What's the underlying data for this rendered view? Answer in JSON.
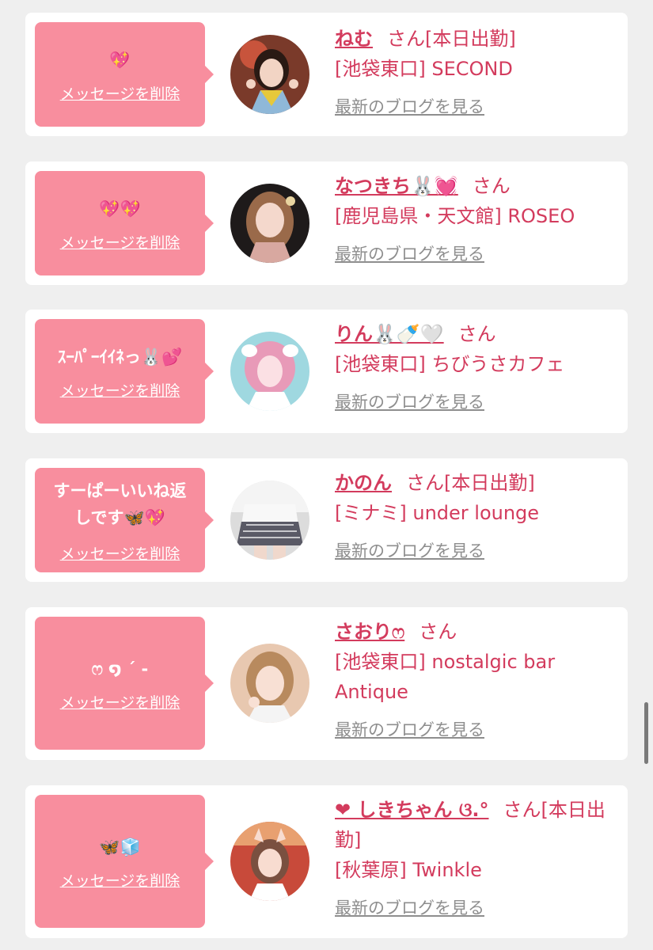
{
  "delete_label": "メッセージを削除",
  "blog_label": "最新のブログを見る",
  "entries": [
    {
      "message": "💖",
      "name": "ねむ",
      "suffix": "さん[本日出勤]",
      "shop": "[池袋東口] SECOND"
    },
    {
      "message": "💖💖",
      "name": "なつきち🐰💓",
      "suffix": "さん",
      "shop": "[鹿児島県・天文館] ROSEO"
    },
    {
      "message": "ｽｰﾊﾟｰｲｲﾈっ🐰💕",
      "name": "りん🐰🍼🤍",
      "suffix": "さん",
      "shop": "[池袋東口] ちびうさカフェ"
    },
    {
      "message": "すーぱーいいね返しです🦋💖",
      "name": "かのん",
      "suffix": "さん[本日出勤]",
      "shop": "[ミナミ] under lounge"
    },
    {
      "message": "ෆ ໑ ˊ -",
      "name": "さおりෆ",
      "suffix": "さん",
      "shop": "[池袋東口] nostalgic bar Antique"
    },
    {
      "message": "🦋🧊",
      "name": "❤ しきちゃん ଓ.°",
      "suffix": "さん[本日出勤]",
      "shop": "[秋葉原] Twinkle"
    }
  ],
  "colors": {
    "accent": "#d33b5d",
    "bubble": "#f88e9e",
    "background": "#efefef",
    "link_gray": "#8e8e8e"
  }
}
